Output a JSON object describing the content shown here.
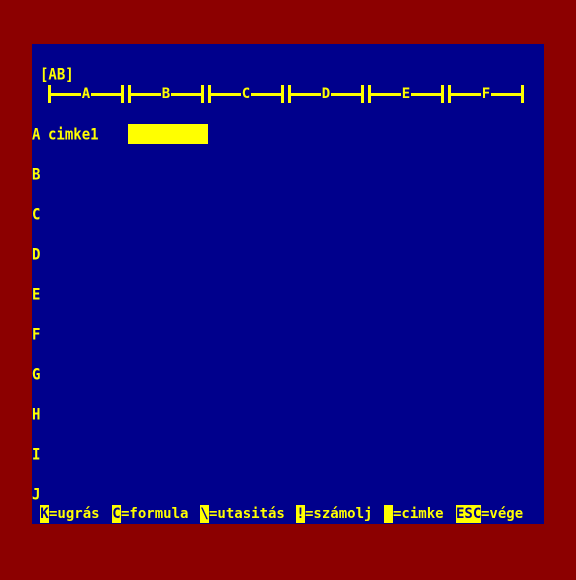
{
  "cell_reference": "[AB]",
  "columns": [
    "A",
    "B",
    "C",
    "D",
    "E",
    "F"
  ],
  "rows": [
    "A",
    "B",
    "C",
    "D",
    "E",
    "F",
    "G",
    "H",
    "I",
    "J"
  ],
  "cells": {
    "A1": "cimke1"
  },
  "status_bar": [
    {
      "key": "K",
      "label": "=ugrás"
    },
    {
      "key": "C",
      "label": "=formula"
    },
    {
      "key": "\\",
      "label": "=utasitás"
    },
    {
      "key": "!",
      "label": "=számolj"
    },
    {
      "key": "",
      "label": "=cimke"
    },
    {
      "key": "ESC",
      "label": "=vége"
    }
  ],
  "colors": {
    "border": "#8c0000",
    "screen": "#00008c",
    "text": "#ffff00"
  }
}
